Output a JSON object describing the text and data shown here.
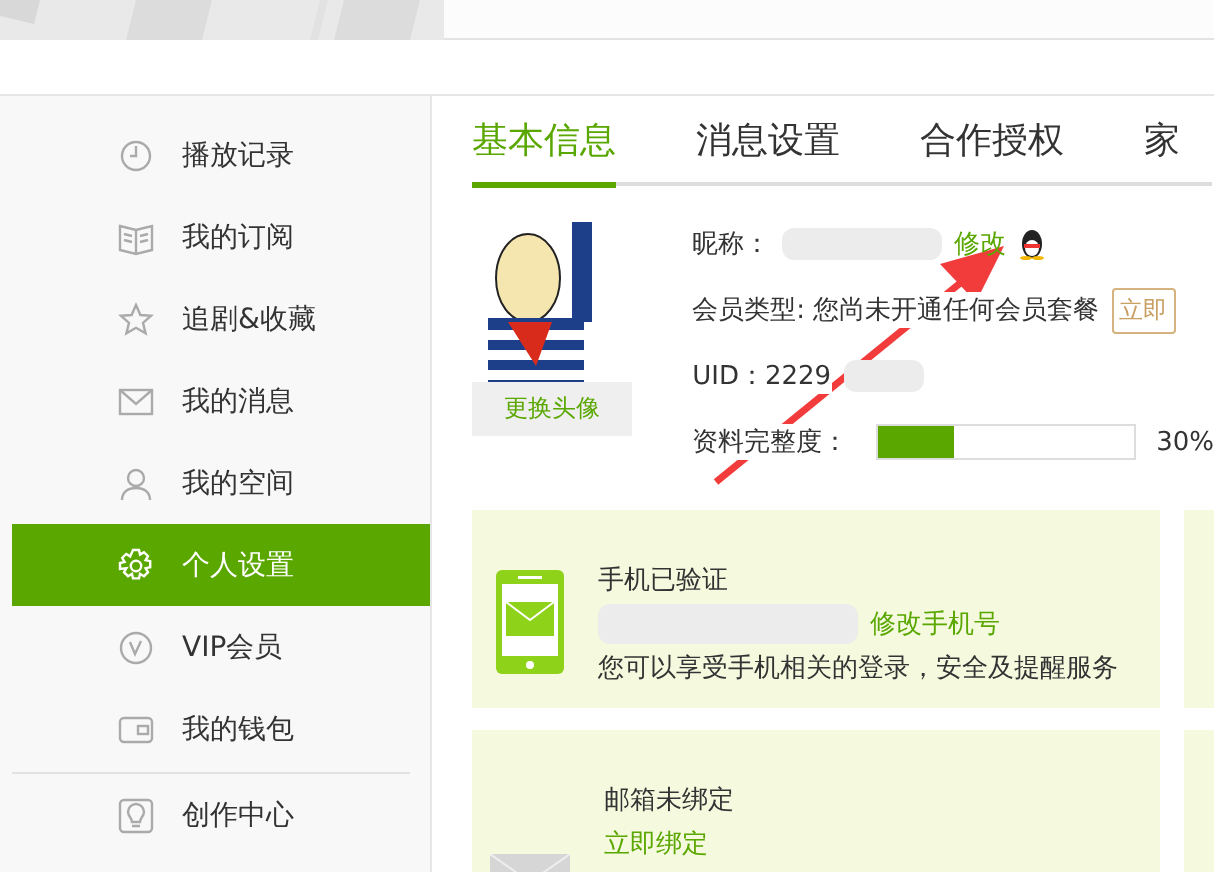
{
  "sidebar": {
    "items": [
      {
        "kind": "clock",
        "label": "播放记录",
        "selected": false
      },
      {
        "kind": "book",
        "label": "我的订阅",
        "selected": false
      },
      {
        "kind": "star",
        "label": "追剧&收藏",
        "selected": false
      },
      {
        "kind": "mail",
        "label": "我的消息",
        "selected": false
      },
      {
        "kind": "person",
        "label": "我的空间",
        "selected": false
      },
      {
        "kind": "gear",
        "label": "个人设置",
        "selected": true
      },
      {
        "kind": "vip",
        "label": "VIP会员",
        "selected": false
      },
      {
        "kind": "wallet",
        "label": "我的钱包",
        "selected": false
      },
      {
        "kind": "bulb",
        "label": "创作中心",
        "selected": false
      }
    ]
  },
  "tabs": [
    {
      "label": "基本信息",
      "selected": true
    },
    {
      "label": "消息设置",
      "selected": false
    },
    {
      "label": "合作授权",
      "selected": false
    },
    {
      "label": "家",
      "selected": false
    }
  ],
  "profile": {
    "change_avatar": "更换头像",
    "nickname_label": "昵称：",
    "edit_link": "修改",
    "member_label": "会员类型: 您尚未开通任何会员套餐",
    "open_button": "立即",
    "uid": "UID：2229",
    "completeness_label": "资料完整度：",
    "completeness": {
      "level": 0.3,
      "reading": "30%"
    }
  },
  "cards": [
    {
      "kind": "phone",
      "title": "手机已验证",
      "link": "修改手机号",
      "description": "您可以享受手机相关的登录，安全及提醒服务"
    },
    {
      "kind": "email",
      "title": "邮箱未绑定",
      "link": "立即绑定"
    }
  ]
}
